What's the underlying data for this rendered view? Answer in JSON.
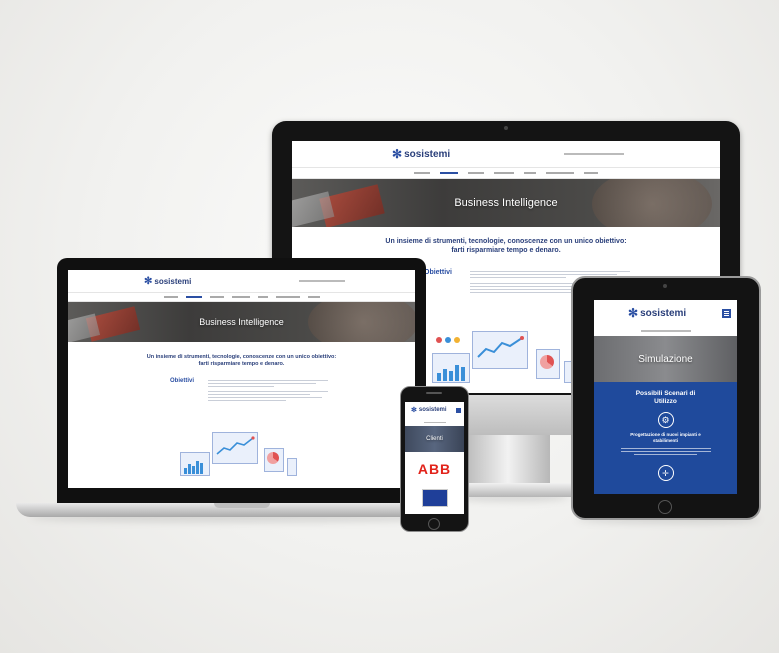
{
  "brand": {
    "name": "sosistemi",
    "blue": "#2b4fa3",
    "dark_blue": "#1f4a9c"
  },
  "desktop_site": {
    "hero_title": "Business Intelligence",
    "tagline_line1": "Un insieme di strumenti, tecnologie, conoscenze con un unico obiettivo:",
    "tagline_line2": "farti risparmiare tempo e denaro.",
    "section_title": "Obiettivi"
  },
  "laptop_site": {
    "hero_title": "Business Intelligence",
    "tagline_line1": "Un insieme di strumenti, tecnologie, conoscenze con un unico obiettivo:",
    "tagline_line2": "farti risparmiare tempo e denaro.",
    "section_title": "Obiettivi"
  },
  "tablet_site": {
    "hero_title": "Simulazione",
    "box_title_line1": "Possibili Scenari di",
    "box_title_line2": "Utilizzo",
    "box_subtitle_line1": "Progettazione di nuovi impianti e",
    "box_subtitle_line2": "stabilimenti"
  },
  "phone_site": {
    "hero_title": "Clienti",
    "client_logo": "ABB"
  },
  "icons": [
    "sosistemi-logo-icon",
    "menu-icon",
    "gear-icon",
    "pointer-icon"
  ]
}
